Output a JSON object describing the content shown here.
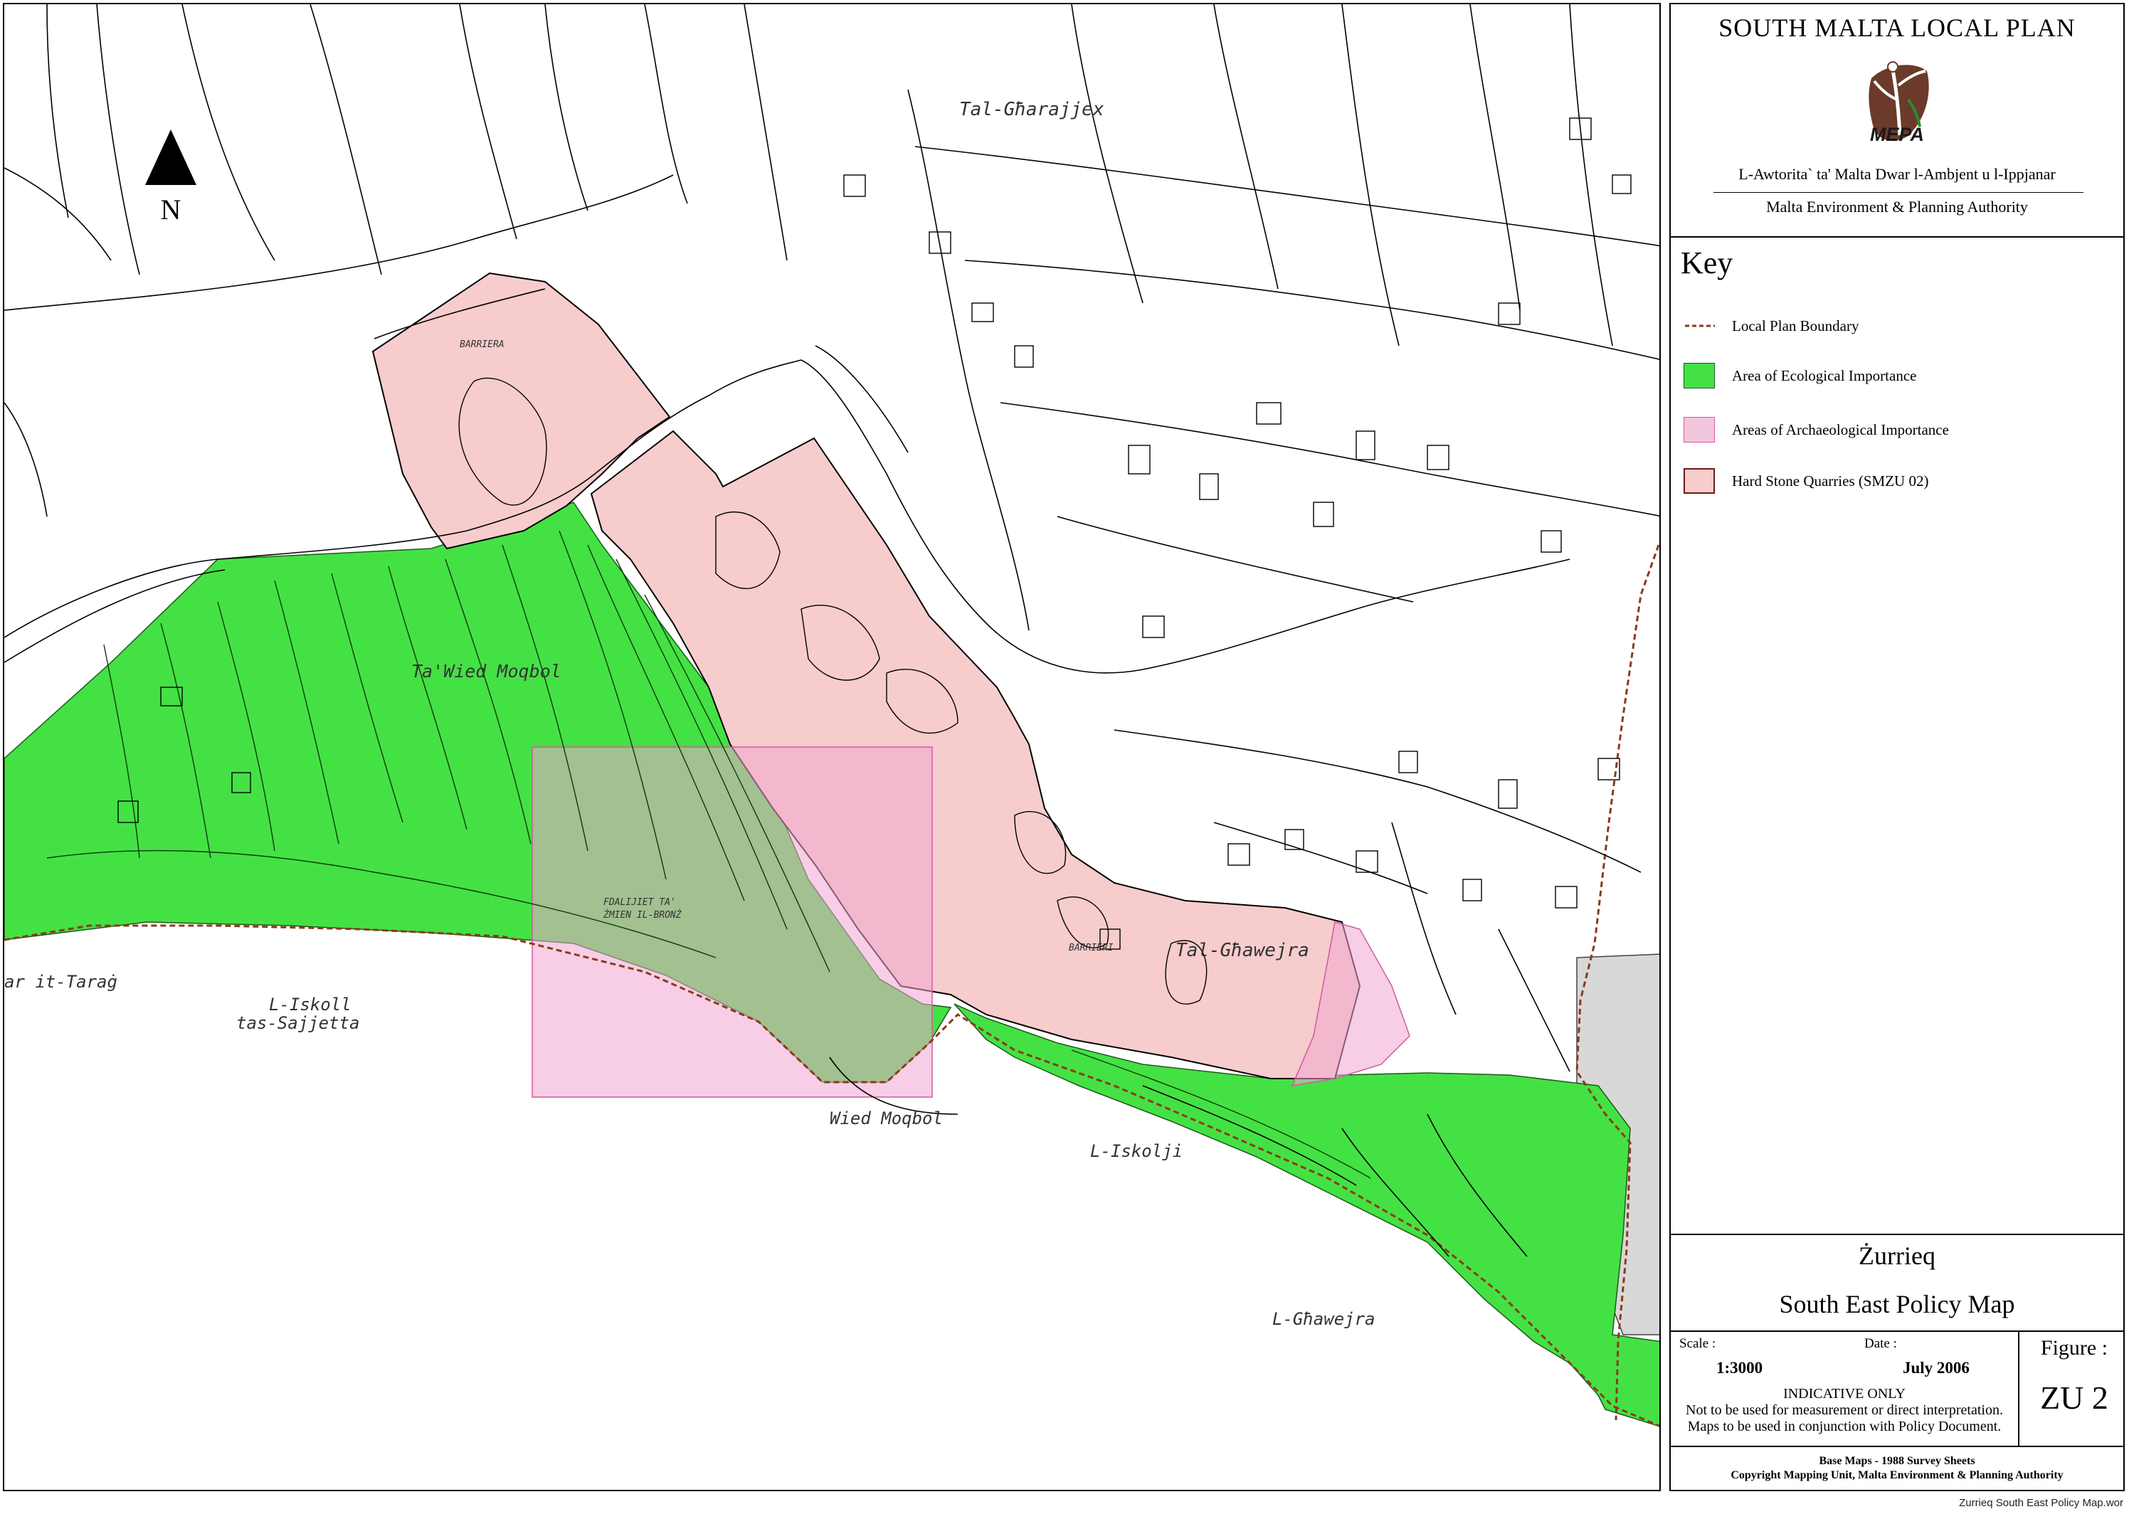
{
  "panel": {
    "title": "SOUTH MALTA LOCAL PLAN",
    "logo_word": "MEPA",
    "authority_mt": "L-Awtorita` ta' Malta Dwar l-Ambjent u l-Ippjanar",
    "authority_en": "Malta Environment & Planning Authority"
  },
  "key": {
    "title": "Key",
    "items": [
      {
        "label": "Local Plan Boundary",
        "symbol": "dashed-line",
        "color": "#8b3a1a"
      },
      {
        "label": "Area of Ecological Importance",
        "symbol": "fill",
        "color": "#44e144"
      },
      {
        "label": "Areas of Archaeological Importance",
        "symbol": "fill",
        "color": "#f3c6dd"
      },
      {
        "label": "Hard Stone Quarries (SMZU 02)",
        "symbol": "fill",
        "color": "#f7cccc"
      }
    ]
  },
  "titleblock": {
    "place": "Żurrieq",
    "subtitle": "South East Policy Map",
    "scale_label": "Scale :",
    "scale_value": "1:3000",
    "date_label": "Date :",
    "date_value": "July 2006",
    "indicative_1": "INDICATIVE ONLY",
    "indicative_2": "Not to be used for measurement or direct interpretation.",
    "indicative_3": "Maps to be used in conjunction with Policy Document.",
    "figure_label": "Figure :",
    "figure_value": "ZU 2",
    "credits_1": "Base Maps - 1988 Survey Sheets",
    "credits_2": "Copyright Mapping Unit, Malta Environment & Planning Authority"
  },
  "map": {
    "north": "N",
    "labels": {
      "tal_gharajjex": "Tal-Għarajjex",
      "barriera": "BARRIERA",
      "ta_wied_moqbol": "Ta'Wied Moqbol",
      "fdalijiet_1": "FDALIJIET TA'",
      "fdalijiet_2": "ŻMIEN IL-BRONŻ",
      "barrieri": "BARRIERI",
      "tal_ghawejra": "Tal-Għawejra",
      "ghar_it_tarag": "ar it-Taraġ",
      "l_iskoll_1": "L-Iskoll",
      "l_iskoll_2": "tas-Sajjetta",
      "wied_moqbol": "Wied Moqbol",
      "l_iskolji": "L-Iskolji",
      "l_ghawejra": "L-Għawejra"
    },
    "colors": {
      "ecological": "#44e144",
      "archaeological": "#f3c6dd",
      "quarry": "#f7cccc",
      "boundary": "#8b3a1a",
      "built_up": "#d8d8d8"
    }
  },
  "footer": {
    "filename": "Zurrieq South East Policy Map.wor"
  }
}
